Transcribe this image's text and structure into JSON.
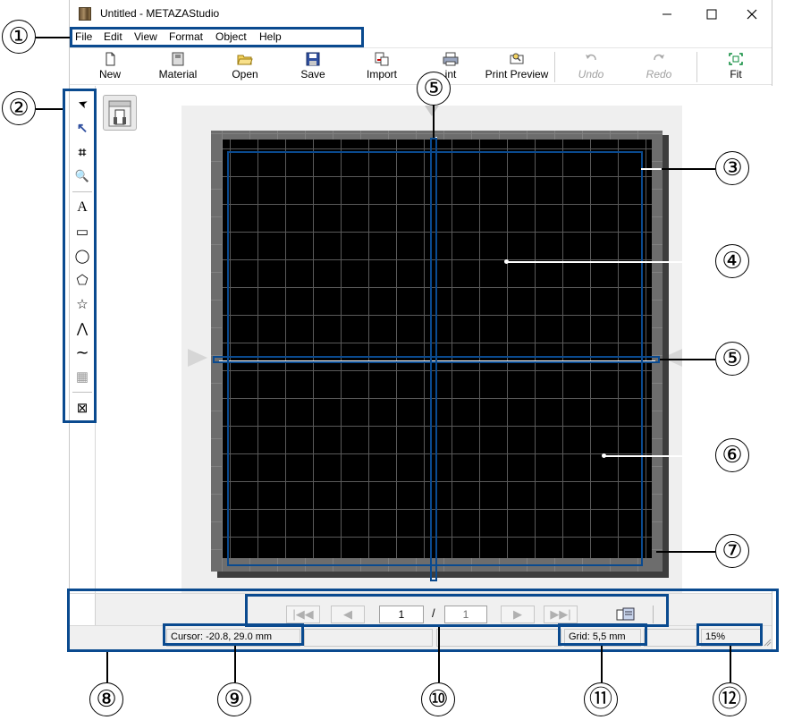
{
  "window": {
    "title": "Untitled - METAZAStudio",
    "controls": {
      "minimize": "—",
      "maximize": "☐",
      "close": "✕"
    }
  },
  "menu": {
    "items": [
      "File",
      "Edit",
      "View",
      "Format",
      "Object",
      "Help"
    ]
  },
  "toolbar": {
    "buttons": [
      {
        "label": "New",
        "icon": "new-document-icon",
        "enabled": true
      },
      {
        "label": "Material",
        "icon": "material-icon",
        "enabled": true
      },
      {
        "label": "Open",
        "icon": "open-folder-icon",
        "enabled": true
      },
      {
        "label": "Save",
        "icon": "save-icon",
        "enabled": true
      },
      {
        "label": "Import",
        "icon": "import-icon",
        "enabled": true
      },
      {
        "label": "Print",
        "icon": "printer-icon",
        "enabled": true,
        "visible_text": "int"
      },
      {
        "label": "Print Preview",
        "icon": "print-preview-icon",
        "enabled": true
      },
      {
        "label": "Undo",
        "icon": "undo-icon",
        "enabled": false
      },
      {
        "label": "Redo",
        "icon": "redo-icon",
        "enabled": false
      },
      {
        "label": "Fit",
        "icon": "fit-icon",
        "enabled": true
      }
    ]
  },
  "tools": [
    {
      "name": "select-tool",
      "icon": "arrow-pointer-icon",
      "glyph": "➤"
    },
    {
      "name": "node-edit-tool",
      "icon": "node-edit-icon",
      "glyph": "↖"
    },
    {
      "name": "crop-tool",
      "icon": "crop-icon",
      "glyph": "⌗"
    },
    {
      "name": "zoom-tool",
      "icon": "magnifier-icon",
      "glyph": "🔍"
    },
    {
      "name": "text-tool",
      "icon": "text-icon",
      "glyph": "A"
    },
    {
      "name": "rectangle-tool",
      "icon": "rectangle-icon",
      "glyph": "▭"
    },
    {
      "name": "ellipse-tool",
      "icon": "ellipse-icon",
      "glyph": "◯"
    },
    {
      "name": "polygon-tool",
      "icon": "pentagon-icon",
      "glyph": "⬠"
    },
    {
      "name": "star-tool",
      "icon": "star-icon",
      "glyph": "☆"
    },
    {
      "name": "polyline-tool",
      "icon": "polyline-icon",
      "glyph": "⋀"
    },
    {
      "name": "curve-tool",
      "icon": "curve-icon",
      "glyph": "∼"
    },
    {
      "name": "qr-code-tool",
      "icon": "qr-code-icon",
      "glyph": "▦"
    },
    {
      "name": "image-tool",
      "icon": "image-frame-icon",
      "glyph": "⊠"
    }
  ],
  "navigation": {
    "current_page": "1",
    "separator": "/",
    "total_pages": "1"
  },
  "status": {
    "cursor": "Cursor: -20.8, 29.0 mm",
    "grid": "Grid: 5,5 mm",
    "zoom": "15%"
  },
  "callouts": [
    "①",
    "②",
    "③",
    "④",
    "⑤",
    "⑤",
    "⑥",
    "⑦",
    "⑧",
    "⑨",
    "⑩",
    "⑪",
    "⑫"
  ],
  "colors": {
    "highlight": "#0a4a8f",
    "design_area": "#000000",
    "material": "#6d6d6d",
    "workarea": "#efefef"
  }
}
